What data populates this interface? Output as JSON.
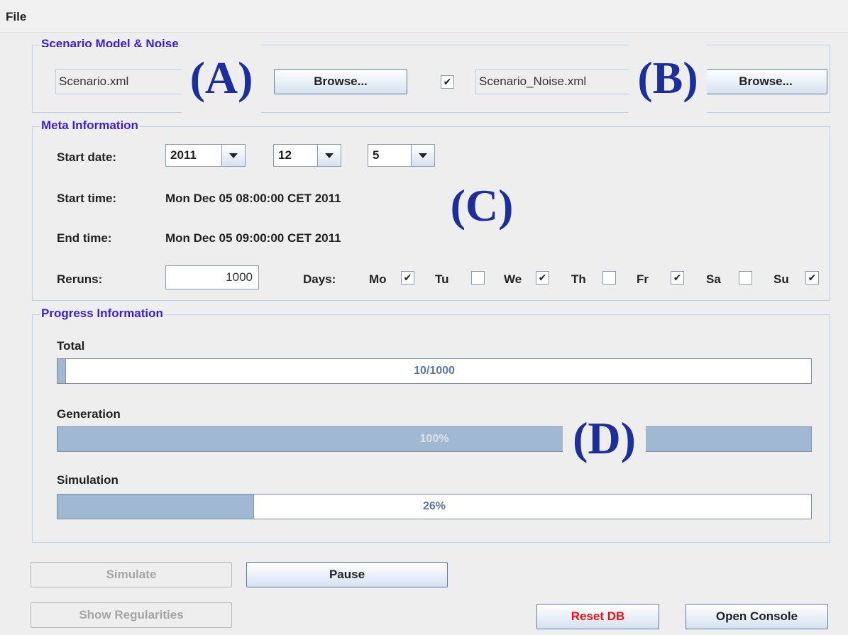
{
  "menu": {
    "file": "File"
  },
  "scenario": {
    "legend": "Scenario Model & Noise",
    "model_file": "Scenario.xml",
    "browse_label": "Browse...",
    "noise_checked": true,
    "noise_file": "Scenario_Noise.xml",
    "browse2_label": "Browse..."
  },
  "meta": {
    "legend": "Meta Information",
    "start_date_label": "Start date:",
    "year": "2011",
    "month": "12",
    "day": "5",
    "start_time_label": "Start time:",
    "start_time": "Mon Dec 05 08:00:00 CET 2011",
    "end_time_label": "End time:",
    "end_time": "Mon Dec 05 09:00:00 CET 2011",
    "reruns_label": "Reruns:",
    "reruns": "1000",
    "days_label": "Days:",
    "days": [
      {
        "label": "Mo",
        "checked": true
      },
      {
        "label": "Tu",
        "checked": false
      },
      {
        "label": "We",
        "checked": true
      },
      {
        "label": "Th",
        "checked": false
      },
      {
        "label": "Fr",
        "checked": true
      },
      {
        "label": "Sa",
        "checked": false
      },
      {
        "label": "Su",
        "checked": true
      }
    ]
  },
  "progress": {
    "legend": "Progress Information",
    "bars": [
      {
        "label": "Total",
        "text": "10/1000",
        "fraction": 0.01
      },
      {
        "label": "Generation",
        "text": "100%",
        "fraction": 1.0
      },
      {
        "label": "Simulation",
        "text": "26%",
        "fraction": 0.26
      }
    ]
  },
  "buttons": {
    "simulate": "Simulate",
    "pause": "Pause",
    "show_regularities": "Show Regularities",
    "reset_db": "Reset DB",
    "open_console": "Open Console"
  },
  "annotations": {
    "a": "(A)",
    "b": "(B)",
    "c": "(C)",
    "d": "(D)"
  },
  "colors": {
    "legend": "#3b1ee0",
    "annotation": "#1c2d9c",
    "progress_fill": "#a0b8d2",
    "progress_text": "#5c79a8",
    "reset_text": "#ee1111"
  }
}
